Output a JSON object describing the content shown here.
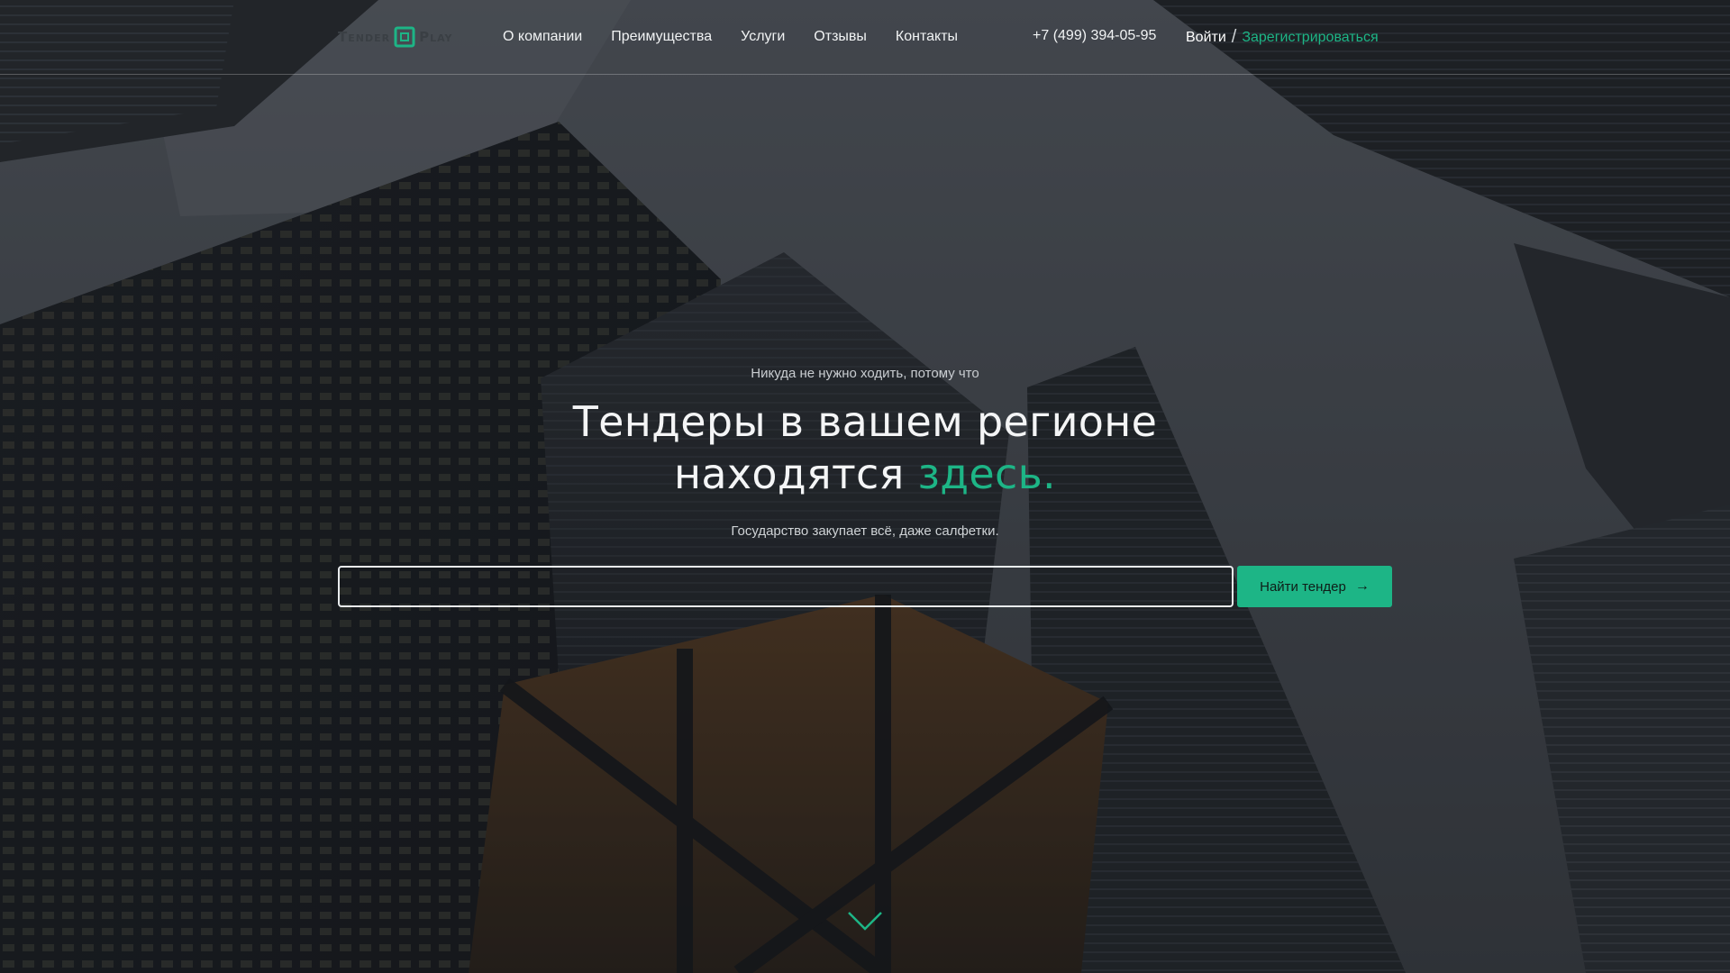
{
  "brand": {
    "name_part1": "Tender",
    "name_part2": "Play",
    "accent_color": "#1db586"
  },
  "nav": {
    "items": [
      {
        "label": "О компании"
      },
      {
        "label": "Преимущества"
      },
      {
        "label": "Услуги"
      },
      {
        "label": "Отзывы"
      },
      {
        "label": "Контакты"
      }
    ],
    "phone": "+7 (499) 394-05-95",
    "login": "Войти",
    "separator": "/",
    "register": "Зарегистрироваться"
  },
  "hero": {
    "eyebrow": "Никуда не нужно ходить, потому что",
    "title_line1": "Тендеры в вашем регионе",
    "title_line2_prefix": "находятся ",
    "title_line2_accent": "здесь.",
    "subtitle": "Государство закупает всё, даже салфетки.",
    "search_value": "",
    "search_button": "Найти тендер",
    "search_button_icon": "arrow-right-icon",
    "scroll_icon": "chevron-down-icon"
  }
}
